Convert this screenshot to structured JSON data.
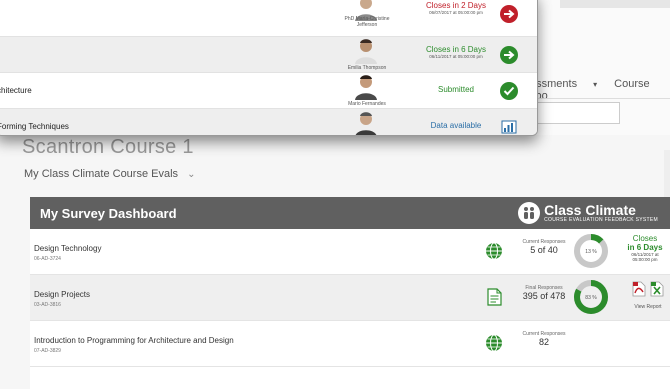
{
  "lms": {
    "nav_items": [
      "essments",
      "Course Too"
    ],
    "nav_caret": "▾",
    "course_title": "Scantron Course 1",
    "course_menu": "My Class Climate Course Evals",
    "course_menu_chevron": "⌄"
  },
  "popup": {
    "rows": [
      {
        "name": "",
        "instructor": [
          "PhD Maria-Christine",
          "Jefferson"
        ],
        "status": "Closes in 2 Days",
        "status_sub": "06/07/2017 at 05:00:00 pm",
        "status_color": "#c0202a",
        "button": "arrow-red"
      },
      {
        "name": "",
        "instructor": [
          "Emilia Thompson"
        ],
        "status": "Closes in 6 Days",
        "status_sub": "06/11/2017 at 05:00:00 pm",
        "status_color": "#2c8c2c",
        "button": "arrow-green"
      },
      {
        "name": "chitecture",
        "instructor": [
          "Mario Fernandes"
        ],
        "status": "Submitted",
        "status_sub": "",
        "status_color": "#2c8c2c",
        "button": "check-green"
      },
      {
        "name": "Forming Techniques",
        "instructor": [],
        "status": "Data available",
        "status_sub": "",
        "status_color": "#2a6ea6",
        "button": "chart"
      }
    ]
  },
  "dashboard": {
    "title": "My Survey Dashboard",
    "logo_name": "Class Climate",
    "logo_tag": "COURSE EVALUATION FEEDBACK SYSTEM",
    "rows": [
      {
        "name": "Design Technology",
        "code": "06-AD-3724",
        "icon": "globe-icon",
        "resp_label": "Current Responses",
        "resp_value": "5 of 40",
        "percent": "13 %",
        "progress": 0.13,
        "status": [
          "Closes",
          "in 6 Days",
          "06/11/2017 at",
          "05:00:00 pm"
        ]
      },
      {
        "name": "Design Projects",
        "code": "03-AD-3816",
        "icon": "document-icon",
        "resp_label": "Final Responses",
        "resp_value": "395 of 478",
        "percent": "83 %",
        "progress": 0.83,
        "report_label": "View Report"
      },
      {
        "name": "Introduction to Programming for Architecture and Design",
        "code": "07-AD-3829",
        "icon": "globe-icon",
        "resp_label": "Current Responses",
        "resp_value": "82"
      }
    ]
  },
  "colors": {
    "header_bg": "#606060",
    "green": "#2c8c2c",
    "red": "#c0202a",
    "donut_track": "#c8c8c8"
  }
}
